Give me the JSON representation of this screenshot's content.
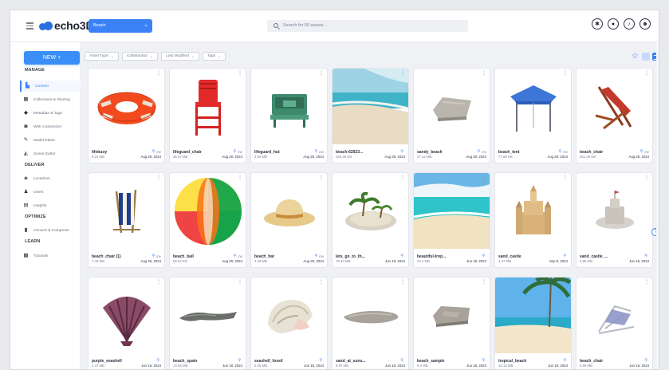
{
  "header": {
    "logo_text": "echo3D",
    "project": "Beach",
    "search_placeholder": "Search for 50 assets...",
    "icons": [
      "puzzle-icon",
      "drop-icon",
      "bell-icon",
      "user-icon"
    ]
  },
  "sidebar": {
    "new_label": "NEW +",
    "sections": [
      {
        "title": "MANAGE",
        "items": [
          {
            "label": "Content",
            "icon": "content-icon",
            "active": true
          },
          {
            "label": "Collections & Sharing",
            "icon": "grid-icon"
          },
          {
            "label": "Metadata & Tags",
            "icon": "tag-icon"
          },
          {
            "label": "Web Customizer",
            "icon": "vr-icon"
          },
          {
            "label": "Model Editor",
            "icon": "pencil-icon"
          },
          {
            "label": "Scene Editor",
            "icon": "shapes-icon"
          }
        ]
      },
      {
        "title": "DELIVER",
        "items": [
          {
            "label": "Locations",
            "icon": "location-icon"
          },
          {
            "label": "Users",
            "icon": "person-icon"
          },
          {
            "label": "Insights",
            "icon": "chart-icon"
          }
        ]
      },
      {
        "title": "OPTIMIZE",
        "items": [
          {
            "label": "Convert & Compress",
            "icon": "file-icon"
          }
        ]
      },
      {
        "title": "LEARN",
        "items": [
          {
            "label": "Tutorials",
            "icon": "tutorials-icon"
          }
        ]
      }
    ]
  },
  "filters": [
    "Asset Type",
    "Collaborator",
    "Last Modified",
    "Tags"
  ],
  "assets": [
    {
      "name": "lifebuoy",
      "size": "9.31 MB",
      "owner": "me",
      "date": "Aug 29, 2024",
      "icon": "lifebuoy"
    },
    {
      "name": "lifeguard_chair",
      "size": "35.57 MB",
      "owner": "me",
      "date": "Aug 29, 2024",
      "icon": "lifeguard-chair"
    },
    {
      "name": "lifeguard_hut",
      "size": "3.94 MB",
      "owner": "me",
      "date": "Aug 29, 2024",
      "icon": "lifeguard-hut"
    },
    {
      "name": "beach-62923...",
      "size": "325.46 KB",
      "owner": "",
      "date": "Aug 29, 2024",
      "icon": "beach-photo"
    },
    {
      "name": "sandy_beach",
      "size": "37.12 MB",
      "owner": "me",
      "date": "Aug 29, 2024",
      "icon": "sand-slab"
    },
    {
      "name": "beach_tent",
      "size": "77.89 KB",
      "owner": "me",
      "date": "Aug 29, 2024",
      "icon": "beach-tent"
    },
    {
      "name": "beach_chair",
      "size": "251.29 KB",
      "owner": "me",
      "date": "Aug 29, 2024",
      "icon": "deck-chair"
    },
    {
      "name": "beach_chair (1)",
      "size": "7.45 MB",
      "owner": "me",
      "date": "Aug 29, 2024",
      "icon": "striped-chair"
    },
    {
      "name": "beach_ball",
      "size": "58.63 KB",
      "owner": "me",
      "date": "Aug 29, 2024",
      "icon": "beach-ball"
    },
    {
      "name": "beach_hat",
      "size": "3.48 MB",
      "owner": "me",
      "date": "Aug 29, 2024",
      "icon": "beach-hat"
    },
    {
      "name": "lets_go_to_th...",
      "size": "79.42 MB",
      "owner": "",
      "date": "Jun 18, 2024",
      "icon": "island"
    },
    {
      "name": "beautiful-trop...",
      "size": "10.1 MB",
      "owner": "",
      "date": "Jun 18, 2024",
      "icon": "tropical-photo"
    },
    {
      "name": "sand_castle",
      "size": "4.47 MB",
      "owner": "",
      "date": "Sep 9, 2024",
      "icon": "sand-castle"
    },
    {
      "name": "sand_castle_...",
      "size": "6.96 MB",
      "owner": "",
      "date": "Jun 18, 2024",
      "icon": "sand-castle-2"
    },
    {
      "name": "purple_seashell",
      "size": "4.37 MB",
      "owner": "",
      "date": "Jun 18, 2024",
      "icon": "seashell"
    },
    {
      "name": "beach_spain",
      "size": "13.93 MB",
      "owner": "",
      "date": "Jun 18, 2024",
      "icon": "rock-strip"
    },
    {
      "name": "seashell_fossil",
      "size": "5.55 MB",
      "owner": "",
      "date": "Jun 18, 2024",
      "icon": "conch"
    },
    {
      "name": "sand_at_suns...",
      "size": "8.97 MB",
      "owner": "",
      "date": "Jun 18, 2024",
      "icon": "sand-patch"
    },
    {
      "name": "beach_sample",
      "size": "9.2 MB",
      "owner": "",
      "date": "Jun 18, 2024",
      "icon": "sand-slab-2"
    },
    {
      "name": "tropical_beach",
      "size": "10.13 MB",
      "owner": "",
      "date": "Jun 18, 2024",
      "icon": "palm-photo"
    },
    {
      "name": "beach_chair",
      "size": "6.96 MB",
      "owner": "",
      "date": "Jun 18, 2024",
      "icon": "lounger"
    }
  ]
}
